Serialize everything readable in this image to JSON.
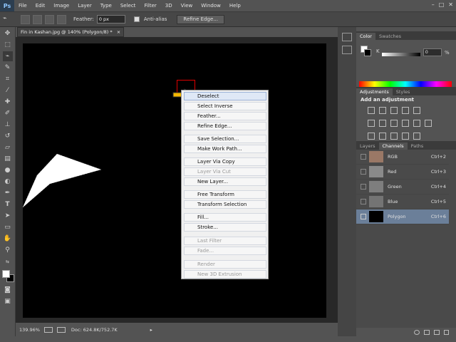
{
  "app": {
    "logo": "Ps"
  },
  "menu": [
    "File",
    "Edit",
    "Image",
    "Layer",
    "Type",
    "Select",
    "Filter",
    "3D",
    "View",
    "Window",
    "Help"
  ],
  "window_controls": [
    "–",
    "□",
    "✕"
  ],
  "options": {
    "feather_label": "Feather:",
    "feather_value": "0 px",
    "antialias_label": "Anti-alias",
    "refine_label": "Refine Edge..."
  },
  "document": {
    "tab_title": "Fin in Kashan.jpg @ 140% (Polygon/8) *",
    "tab_close": "×"
  },
  "status": {
    "zoom": "139.96%",
    "doc_info": "Doc: 624.8K/752.7K"
  },
  "color_panel": {
    "tabs": [
      "Color",
      "Swatches"
    ],
    "channel_label": "K",
    "value": "0",
    "unit": "%"
  },
  "adjustments_panel": {
    "tabs": [
      "Adjustments",
      "Styles"
    ],
    "heading": "Add an adjustment"
  },
  "channels_panel": {
    "tabs": [
      "Layers",
      "Channels",
      "Paths"
    ],
    "rows": [
      {
        "name": "RGB",
        "shortcut": "Ctrl+2"
      },
      {
        "name": "Red",
        "shortcut": "Ctrl+3"
      },
      {
        "name": "Green",
        "shortcut": "Ctrl+4"
      },
      {
        "name": "Blue",
        "shortcut": "Ctrl+5"
      },
      {
        "name": "Polygon",
        "shortcut": "Ctrl+6"
      }
    ]
  },
  "context_menu": {
    "items": [
      {
        "label": "Deselect",
        "enabled": true,
        "highlighted": true
      },
      {
        "label": "Select Inverse",
        "enabled": true
      },
      {
        "label": "Feather...",
        "enabled": true
      },
      {
        "label": "Refine Edge...",
        "enabled": true
      },
      {
        "label": "Save Selection...",
        "enabled": true
      },
      {
        "label": "Make Work Path...",
        "enabled": true
      },
      {
        "label": "Layer Via Copy",
        "enabled": true
      },
      {
        "label": "Layer Via Cut",
        "enabled": false
      },
      {
        "label": "New Layer...",
        "enabled": true
      },
      {
        "label": "Free Transform",
        "enabled": true
      },
      {
        "label": "Transform Selection",
        "enabled": true
      },
      {
        "label": "Fill...",
        "enabled": true
      },
      {
        "label": "Stroke...",
        "enabled": true
      },
      {
        "label": "Last Filter",
        "enabled": false
      },
      {
        "label": "Fade...",
        "enabled": false
      },
      {
        "label": "Render",
        "enabled": false
      },
      {
        "label": "New 3D Extrusion",
        "enabled": false
      }
    ]
  },
  "colors": {
    "accent_arrow": "#f5b800",
    "highlight_box": "#e00000",
    "selected_row": "#6b7f99"
  }
}
